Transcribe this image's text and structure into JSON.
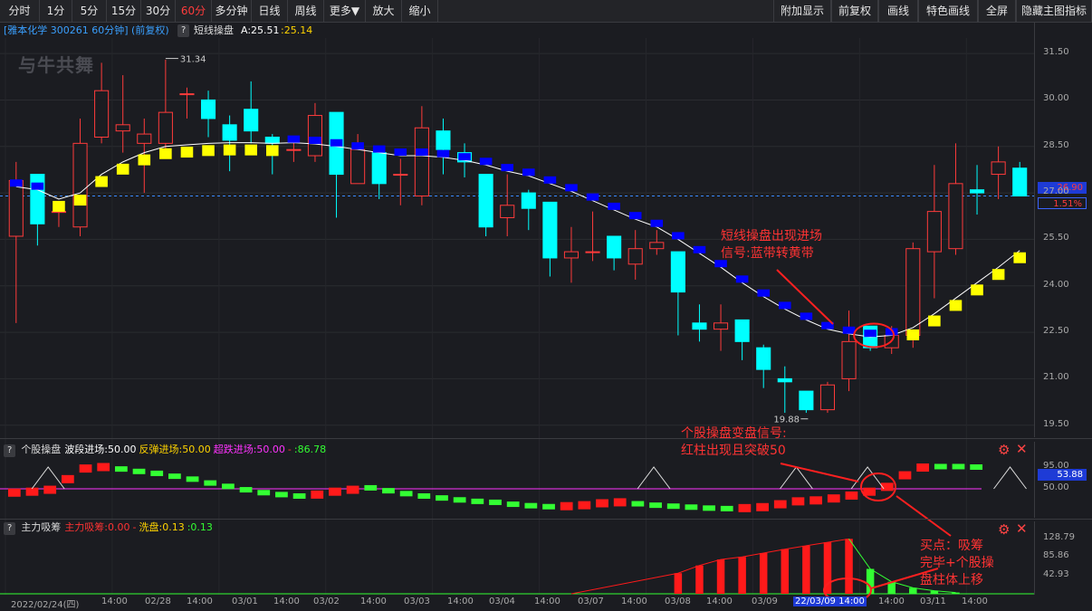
{
  "toolbar": {
    "left": [
      "分时",
      "1分",
      "5分",
      "15分",
      "30分",
      "60分",
      "多分钟",
      "日线",
      "周线",
      "更多▼",
      "放大",
      "缩小"
    ],
    "active": "60分",
    "right": [
      "附加显示",
      "前复权",
      "画线",
      "特色画线",
      "全屏",
      "隐藏主图指标"
    ]
  },
  "main": {
    "stock_label": "[雅本化学 300261 60分钟] (前复权)",
    "help": "?",
    "indicator": "短线操盘",
    "a_value": "A:25.51",
    "b_value": ":25.14",
    "logo": "与牛共舞",
    "y_ticks": [
      "31.50",
      "30.00",
      "28.50",
      "27.00",
      "25.50",
      "24.00",
      "22.50",
      "21.00",
      "19.50"
    ],
    "y_range": [
      19.2,
      32.0
    ],
    "high_label": "31.34",
    "low_label": "19.88",
    "current_price": "26.90",
    "current_pct": "1.51%",
    "annotation": [
      "短线操盘出现进场",
      "信号:蓝带转黄带"
    ]
  },
  "sub1": {
    "help": "?",
    "title": "个股操盘",
    "items": [
      {
        "text": "波段进场:50.00",
        "color": "#ffffff"
      },
      {
        "text": "反弹进场:50.00",
        "color": "#ffd400"
      },
      {
        "text": "超跌进场:50.00",
        "color": "#ff33ff"
      },
      {
        "text": "-",
        "color": "#ff3333"
      },
      {
        "text": ":86.78",
        "color": "#33ff33"
      }
    ],
    "y_ticks": [
      "95.00",
      "50.00"
    ],
    "value_box": "53.88",
    "annotation": [
      "个股操盘变盘信号:",
      "红柱出现且突破50"
    ]
  },
  "sub2": {
    "help": "?",
    "title": "主力吸筹",
    "items": [
      {
        "text": "主力吸筹:0.00",
        "color": "#ff3333"
      },
      {
        "text": "-",
        "color": "#ff3333"
      },
      {
        "text": "洗盘:0.13",
        "color": "#ffd400"
      },
      {
        "text": ":0.13",
        "color": "#33ff33"
      }
    ],
    "y_ticks": [
      "128.79",
      "85.86",
      "42.93"
    ],
    "annotation": [
      "买点：吸筹",
      "完毕+个股操",
      "盘柱体上移"
    ]
  },
  "x_axis": {
    "labels": [
      "2022/02/24(四)",
      "14:00",
      "02/28",
      "14:00",
      "03/01",
      "14:00",
      "03/02",
      "14:00",
      "03/03",
      "14:00",
      "03/04",
      "14:00",
      "03/07",
      "14:00",
      "03/08",
      "14:00",
      "03/09",
      "22/03/09 14:00",
      "14:00",
      "03/11",
      "14:00"
    ]
  },
  "chart_data": [
    {
      "type": "candlestick",
      "title": "短线操盘",
      "ylim": [
        19.2,
        32.0
      ],
      "colors": {
        "up": "#ff3b3b",
        "down": "#00ffff",
        "band_bull": "#ffff00",
        "band_bear": "#0000ff",
        "ma": "#ffffff"
      },
      "candles": [
        [
          25.6,
          27.4,
          28.0,
          22.8
        ],
        [
          27.6,
          26.0,
          27.6,
          25.3
        ],
        [
          26.4,
          26.4,
          26.6,
          25.9
        ],
        [
          25.9,
          28.6,
          29.4,
          25.6
        ],
        [
          28.8,
          30.3,
          31.2,
          28.6
        ],
        [
          29.0,
          29.2,
          30.8,
          28.3
        ],
        [
          28.6,
          28.9,
          29.4,
          27.0
        ],
        [
          28.6,
          29.6,
          31.3,
          28.3
        ],
        [
          30.2,
          30.2,
          30.4,
          29.4
        ],
        [
          30.0,
          29.4,
          30.3,
          28.8
        ],
        [
          29.2,
          28.7,
          29.5,
          27.7
        ],
        [
          29.7,
          29.0,
          30.6,
          28.6
        ],
        [
          28.8,
          28.6,
          28.9,
          27.6
        ],
        [
          28.4,
          28.4,
          28.8,
          28.0
        ],
        [
          28.2,
          29.5,
          29.9,
          28.0
        ],
        [
          29.6,
          27.6,
          29.6,
          26.2
        ],
        [
          27.3,
          28.4,
          28.9,
          27.3
        ],
        [
          28.3,
          27.3,
          28.4,
          26.8
        ],
        [
          27.6,
          27.6,
          28.1,
          26.6
        ],
        [
          26.9,
          29.1,
          29.8,
          26.6
        ],
        [
          29.0,
          28.4,
          29.4,
          27.6
        ],
        [
          28.3,
          28.0,
          28.6,
          27.5
        ],
        [
          27.6,
          25.9,
          27.6,
          25.6
        ],
        [
          26.2,
          26.6,
          27.6,
          25.6
        ],
        [
          27.0,
          26.5,
          27.1,
          25.8
        ],
        [
          26.7,
          24.9,
          26.7,
          24.3
        ],
        [
          24.9,
          25.1,
          25.9,
          24.1
        ],
        [
          25.1,
          25.1,
          26.4,
          24.8
        ],
        [
          25.6,
          24.9,
          25.6,
          24.5
        ],
        [
          24.7,
          25.2,
          25.8,
          24.2
        ],
        [
          25.2,
          25.4,
          25.8,
          25.0
        ],
        [
          25.1,
          23.8,
          25.1,
          22.4
        ],
        [
          22.8,
          22.6,
          23.4,
          22.2
        ],
        [
          22.6,
          22.8,
          23.4,
          21.9
        ],
        [
          22.9,
          22.2,
          22.9,
          21.6
        ],
        [
          22.0,
          21.3,
          22.1,
          20.7
        ],
        [
          21.0,
          20.9,
          21.4,
          19.9
        ],
        [
          20.6,
          20.0,
          20.6,
          19.9
        ],
        [
          20.0,
          20.8,
          20.9,
          19.9
        ],
        [
          21.0,
          22.2,
          23.2,
          20.6
        ],
        [
          22.7,
          22.0,
          22.7,
          21.9
        ],
        [
          22.0,
          22.4,
          22.7,
          21.8
        ],
        [
          22.4,
          25.2,
          25.4,
          22.0
        ],
        [
          25.1,
          26.4,
          27.9,
          23.6
        ],
        [
          25.2,
          27.3,
          28.6,
          25.0
        ],
        [
          27.1,
          27.0,
          27.9,
          26.3
        ],
        [
          27.6,
          28.0,
          28.5,
          26.8
        ],
        [
          27.8,
          26.9,
          28.0,
          26.9
        ]
      ],
      "ma": [
        27.2,
        27.1,
        26.8,
        27.0,
        27.6,
        28.0,
        28.3,
        28.5,
        28.55,
        28.6,
        28.62,
        28.62,
        28.6,
        28.62,
        28.58,
        28.5,
        28.4,
        28.3,
        28.2,
        28.2,
        28.15,
        28.05,
        27.9,
        27.7,
        27.55,
        27.3,
        27.05,
        26.75,
        26.45,
        26.15,
        25.9,
        25.5,
        25.05,
        24.6,
        24.1,
        23.65,
        23.25,
        22.9,
        22.6,
        22.45,
        22.35,
        22.4,
        22.65,
        23.1,
        23.6,
        24.1,
        24.6,
        25.14
      ],
      "band": [
        "bear",
        "bear",
        "bull",
        "bull",
        "bull",
        "bull",
        "bull",
        "bull",
        "bull",
        "bull",
        "bull",
        "bull",
        "bull",
        "bear",
        "bear",
        "bear",
        "bear",
        "bear",
        "bear",
        "bear",
        "bear",
        "bear",
        "bear",
        "bear",
        "bear",
        "bear",
        "bear",
        "bear",
        "bear",
        "bear",
        "bear",
        "bear",
        "bear",
        "bear",
        "bear",
        "bear",
        "bear",
        "bear",
        "bear",
        "bear",
        "bear",
        "bear",
        "bull",
        "bull",
        "bull",
        "bull",
        "bull",
        "bull"
      ]
    },
    {
      "type": "bar",
      "title": "个股操盘",
      "ylim": [
        -10,
        110
      ],
      "reference": 50,
      "values": [
        42,
        44,
        48,
        70,
        92,
        95,
        91,
        86,
        82,
        76,
        70,
        62,
        55,
        48,
        42,
        38,
        35,
        38,
        44,
        48,
        52,
        46,
        40,
        35,
        31,
        27,
        24,
        22,
        18,
        15,
        13,
        14,
        16,
        20,
        22,
        19,
        16,
        14,
        12,
        10,
        9,
        10,
        12,
        18,
        24,
        26,
        30,
        36,
        44,
        54,
        78,
        94,
        96,
        96,
        95
      ],
      "bar_colors": [
        "#ff1a1a",
        "#ff1a1a",
        "#ff1a1a",
        "#ff1a1a",
        "#ff1a1a",
        "#ff1a1a",
        "#33ff33",
        "#33ff33",
        "#33ff33",
        "#33ff33",
        "#33ff33",
        "#33ff33",
        "#33ff33",
        "#33ff33",
        "#33ff33",
        "#33ff33",
        "#33ff33",
        "#ff1a1a",
        "#ff1a1a",
        "#ff1a1a",
        "#33ff33",
        "#33ff33",
        "#33ff33",
        "#33ff33",
        "#33ff33",
        "#33ff33",
        "#33ff33",
        "#33ff33",
        "#33ff33",
        "#33ff33",
        "#33ff33",
        "#ff1a1a",
        "#ff1a1a",
        "#ff1a1a",
        "#ff1a1a",
        "#33ff33",
        "#33ff33",
        "#33ff33",
        "#33ff33",
        "#33ff33",
        "#33ff33",
        "#ff1a1a",
        "#ff1a1a",
        "#ff1a1a",
        "#ff1a1a",
        "#ff1a1a",
        "#ff1a1a",
        "#ff1a1a",
        "#ff1a1a",
        "#ff1a1a",
        "#ff1a1a",
        "#ff1a1a",
        "#33ff33",
        "#33ff33",
        "#33ff33"
      ],
      "triangles_at": [
        1,
        18,
        22,
        24,
        28
      ]
    },
    {
      "type": "bar",
      "title": "主力吸筹",
      "ylim": [
        0,
        135
      ],
      "values": [
        0,
        0,
        0,
        0,
        0,
        0,
        0,
        0,
        0,
        0,
        0,
        0,
        0,
        0,
        0,
        0,
        0,
        0,
        0,
        0,
        0,
        0,
        0,
        0,
        0,
        0,
        0,
        0,
        0,
        0,
        0,
        48,
        66,
        80,
        86,
        95,
        104,
        112,
        120,
        128,
        0,
        0,
        0,
        0,
        0,
        0,
        0,
        0
      ],
      "wash": [
        0,
        0,
        0,
        0,
        0,
        0,
        0,
        0,
        0,
        0,
        0,
        0,
        0,
        0,
        0,
        0,
        0,
        0,
        0,
        0,
        0,
        0,
        0,
        0,
        0,
        0,
        0,
        0,
        0,
        0,
        0,
        0,
        0,
        0,
        0,
        0,
        0,
        0,
        0,
        0,
        58,
        28,
        14,
        7,
        3,
        1,
        0,
        0
      ]
    }
  ]
}
